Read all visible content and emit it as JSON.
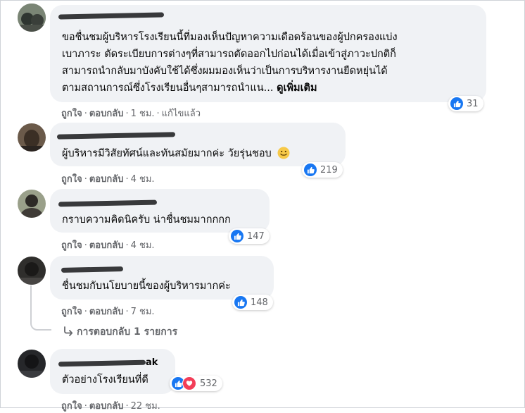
{
  "comments": [
    {
      "text_lines": [
        "ขอชื่นชมผู้บริหารโรงเรียนนี้ที่มองเห็นปัญหาความเดือดร้อนของผู้ปกครองแบ่ง",
        "เบาภาระ ตัดระเบียบการต่างๆที่สามารถตัดออกไปก่อนได้เมื่อเข้าสู่ภาวะปกติก็",
        "สามารถนำกลับมาบังคับใช้ได้ซึ่งผมมองเห็นว่าเป็นการบริหารงานยืดหยุ่นได้",
        "ตามสถานการณ์ซึ่งโรงเรียนอื่นๆสามารถนำแน..."
      ],
      "see_more": "ดูเพิ่มเติม",
      "like": "ถูกใจ",
      "reply": "ตอบกลับ",
      "time": "1 ชม.",
      "edited": "แก้ไขแล้ว",
      "reactions": "31"
    },
    {
      "text": "ผู้บริหารมีวิสัยทัศน์และทันสมัยมากค่ะ วัยรุ่นชอบ",
      "like": "ถูกใจ",
      "reply": "ตอบกลับ",
      "time": "4 ชม.",
      "reactions": "219"
    },
    {
      "text": "กราบความคิดนิครับ น่าชื่นชมมากกกก",
      "like": "ถูกใจ",
      "reply": "ตอบกลับ",
      "time": "4 ชม.",
      "reactions": "147"
    },
    {
      "text": "ชื่นชมกับนโยบายนี้ของผู้บริหารมากค่ะ",
      "like": "ถูกใจ",
      "reply": "ตอบกลับ",
      "time": "7 ชม.",
      "reactions": "148",
      "replies": "การตอบกลับ 1 รายการ"
    },
    {
      "name_suffix": "ak",
      "text": "ตัวอย่างโรงเรียนที่ดี",
      "like": "ถูกใจ",
      "reply": "ตอบกลับ",
      "time": "22 ชม.",
      "reactions": "532"
    }
  ],
  "colors": {
    "bubble": "#f0f2f5",
    "meta": "#65676b",
    "like": "#1877f2",
    "love": "#f33e58"
  }
}
